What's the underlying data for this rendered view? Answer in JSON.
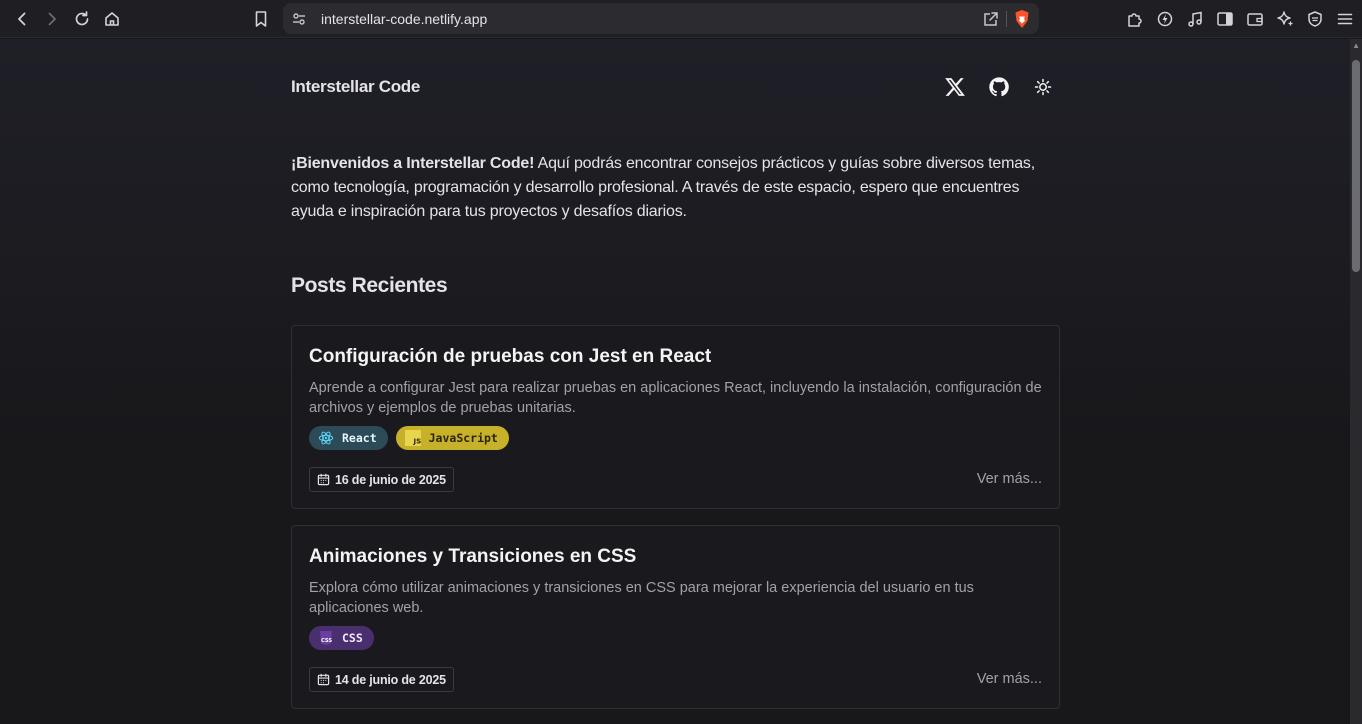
{
  "browser": {
    "url": "interstellar-code.netlify.app",
    "nav": [
      "back-icon",
      "forward-icon",
      "reload-icon",
      "home-icon"
    ],
    "extensions": [
      "puzzle-icon",
      "leo-icon",
      "music-icon",
      "sidebar-icon",
      "wallet-icon",
      "ai-sparkle-icon",
      "vpn-shield-icon",
      "menu-icon"
    ]
  },
  "site": {
    "title": "Interstellar Code",
    "icons": [
      "x-logo-icon",
      "github-icon",
      "sun-icon"
    ]
  },
  "intro": {
    "bold": "¡Bienvenidos a Interstellar Code!",
    "text": " Aquí podrás encontrar consejos prácticos y guías sobre diversos temas, como tecnología, programación y desarrollo profesional. A través de este espacio, espero que encuentres ayuda e inspiración para tus proyectos y desafíos diarios."
  },
  "posts": {
    "heading": "Posts Recientes",
    "items": [
      {
        "title": "Configuración de pruebas con Jest en React",
        "description": "Aprende a configurar Jest para realizar pruebas en aplicaciones React, incluyendo la instalación, configuración de archivos y ejemplos de pruebas unitarias.",
        "tags": [
          {
            "label": "React",
            "icon": "react-icon",
            "color": "#2c4a58"
          },
          {
            "label": "JavaScript",
            "icon": "javascript-icon",
            "color": "#c8b12a"
          }
        ],
        "date": "16 de junio de 2025",
        "more": "Ver más..."
      },
      {
        "title": "Animaciones y Transiciones en CSS",
        "description": "Explora cómo utilizar animaciones y transiciones en CSS para mejorar la experiencia del usuario en tus aplicaciones web.",
        "tags": [
          {
            "label": "CSS",
            "icon": "css-icon",
            "color": "#4a2f6e"
          }
        ],
        "date": "14 de junio de 2025",
        "more": "Ver más..."
      }
    ]
  }
}
